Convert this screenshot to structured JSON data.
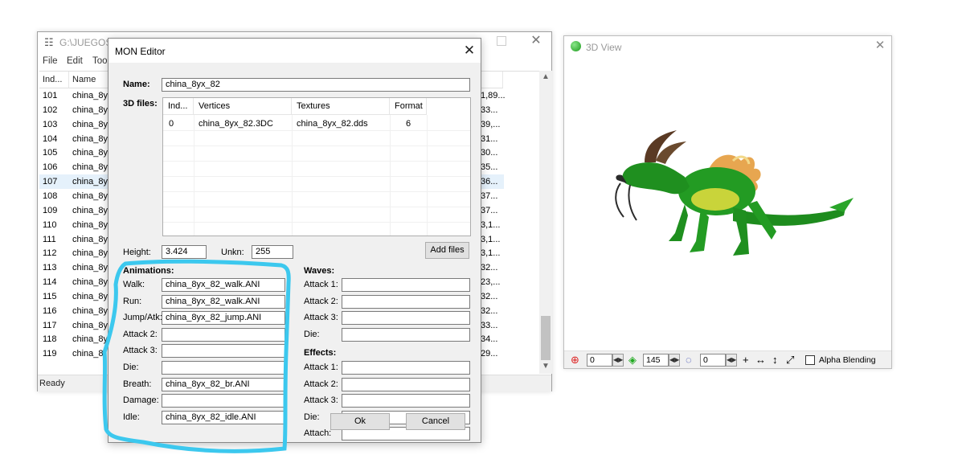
{
  "back_window": {
    "title": "G:\\JUEGOS\\S",
    "menu": [
      "File",
      "Edit",
      "Tool"
    ],
    "columns": [
      "Ind...",
      "Name"
    ],
    "rows": [
      {
        "idx": "101",
        "name": "china_8y",
        "tail": "1,89..."
      },
      {
        "idx": "102",
        "name": "china_8y",
        "tail": "33..."
      },
      {
        "idx": "103",
        "name": "china_8y",
        "tail": "39,..."
      },
      {
        "idx": "104",
        "name": "china_8y",
        "tail": "31..."
      },
      {
        "idx": "105",
        "name": "china_8y",
        "tail": "30..."
      },
      {
        "idx": "106",
        "name": "china_8y",
        "tail": "35..."
      },
      {
        "idx": "107",
        "name": "china_8y",
        "tail": "36..."
      },
      {
        "idx": "108",
        "name": "china_8y",
        "tail": "37..."
      },
      {
        "idx": "109",
        "name": "china_8y",
        "tail": "37..."
      },
      {
        "idx": "110",
        "name": "china_8y",
        "tail": "3,1..."
      },
      {
        "idx": "111",
        "name": "china_8y",
        "tail": "3,1..."
      },
      {
        "idx": "112",
        "name": "china_8y",
        "tail": "3,1..."
      },
      {
        "idx": "113",
        "name": "china_8y",
        "tail": "32..."
      },
      {
        "idx": "114",
        "name": "china_8y",
        "tail": "23,..."
      },
      {
        "idx": "115",
        "name": "china_8y",
        "tail": "32..."
      },
      {
        "idx": "116",
        "name": "china_8y",
        "tail": "32..."
      },
      {
        "idx": "117",
        "name": "china_8y",
        "tail": "33..."
      },
      {
        "idx": "118",
        "name": "china_8y",
        "tail": "34..."
      },
      {
        "idx": "119",
        "name": "china_8",
        "tail": "29..."
      }
    ],
    "selected_row": "107",
    "status": "Ready"
  },
  "editor": {
    "title": "MON Editor",
    "name_label": "Name:",
    "name_value": "china_8yx_82",
    "files_label": "3D files:",
    "files_columns": [
      "Ind...",
      "Vertices",
      "Textures",
      "Format"
    ],
    "files_rows": [
      {
        "index": "0",
        "vertices": "china_8yx_82.3DC",
        "textures": "china_8yx_82.dds",
        "format": "6"
      }
    ],
    "height_label": "Height:",
    "height_value": "3.424",
    "unkn_label": "Unkn:",
    "unkn_value": "255",
    "add_files": "Add files",
    "animations_label": "Animations:",
    "animations": [
      {
        "label": "Walk:",
        "value": "china_8yx_82_walk.ANI"
      },
      {
        "label": "Run:",
        "value": "china_8yx_82_walk.ANI"
      },
      {
        "label": "Jump/Atk:",
        "value": "china_8yx_82_jump.ANI"
      },
      {
        "label": "Attack 2:",
        "value": ""
      },
      {
        "label": "Attack 3:",
        "value": ""
      },
      {
        "label": "Die:",
        "value": ""
      },
      {
        "label": "Breath:",
        "value": "china_8yx_82_br.ANI"
      },
      {
        "label": "Damage:",
        "value": ""
      },
      {
        "label": "Idle:",
        "value": "china_8yx_82_idle.ANI"
      }
    ],
    "waves_label": "Waves:",
    "waves": [
      {
        "label": "Attack 1:",
        "value": ""
      },
      {
        "label": "Attack 2:",
        "value": ""
      },
      {
        "label": "Attack 3:",
        "value": ""
      },
      {
        "label": "Die:",
        "value": ""
      }
    ],
    "effects_label": "Effects:",
    "effects": [
      {
        "label": "Attack 1:",
        "value": ""
      },
      {
        "label": "Attack 2:",
        "value": ""
      },
      {
        "label": "Attack 3:",
        "value": ""
      },
      {
        "label": "Die:",
        "value": ""
      },
      {
        "label": "Attach:",
        "value": ""
      }
    ],
    "ok": "Ok",
    "cancel": "Cancel",
    "highlight_color": "#3cc8ee"
  },
  "view3d": {
    "title": "3D View",
    "spin1": "0",
    "spin2": "145",
    "spin3": "0",
    "alpha_label": "Alpha Blending",
    "alpha_checked": false
  }
}
